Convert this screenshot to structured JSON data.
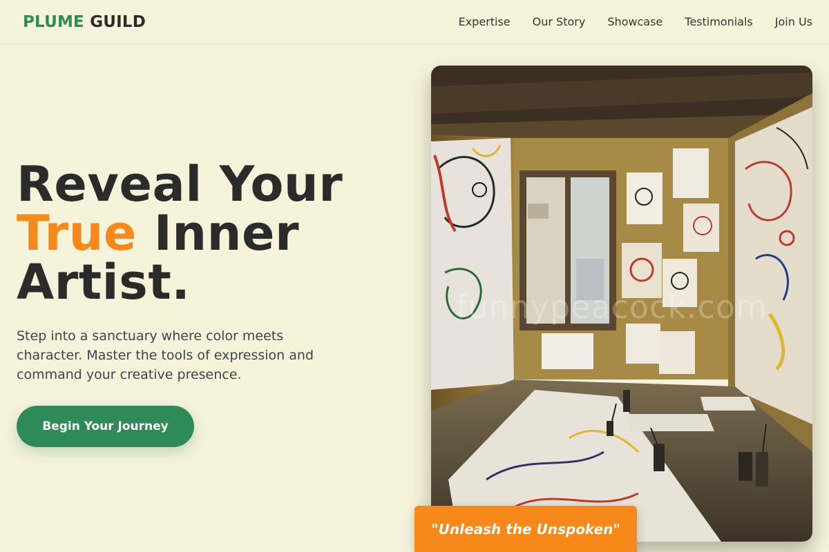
{
  "header": {
    "logo_part1": "PLUME",
    "logo_part2": "GUILD",
    "nav": [
      "Expertise",
      "Our Story",
      "Showcase",
      "Testimonials",
      "Join Us"
    ]
  },
  "hero": {
    "headline_line1": "Reveal Your",
    "headline_accent": "True",
    "headline_line2_rest": " Inner",
    "headline_line3": "Artist.",
    "subtitle": "Step into a sanctuary where color meets character. Master the tools of expression and command your creative presence.",
    "cta_label": "Begin Your Journey"
  },
  "image": {
    "watermark": "funnypeacock.com",
    "icon": "art-studio-photo"
  },
  "badge": {
    "text": "\"Unleash the Unspoken\""
  },
  "colors": {
    "background": "#f5f3da",
    "brand_green": "#2e8b57",
    "accent_orange": "#f7891a",
    "text_dark": "#2b2b2b"
  }
}
